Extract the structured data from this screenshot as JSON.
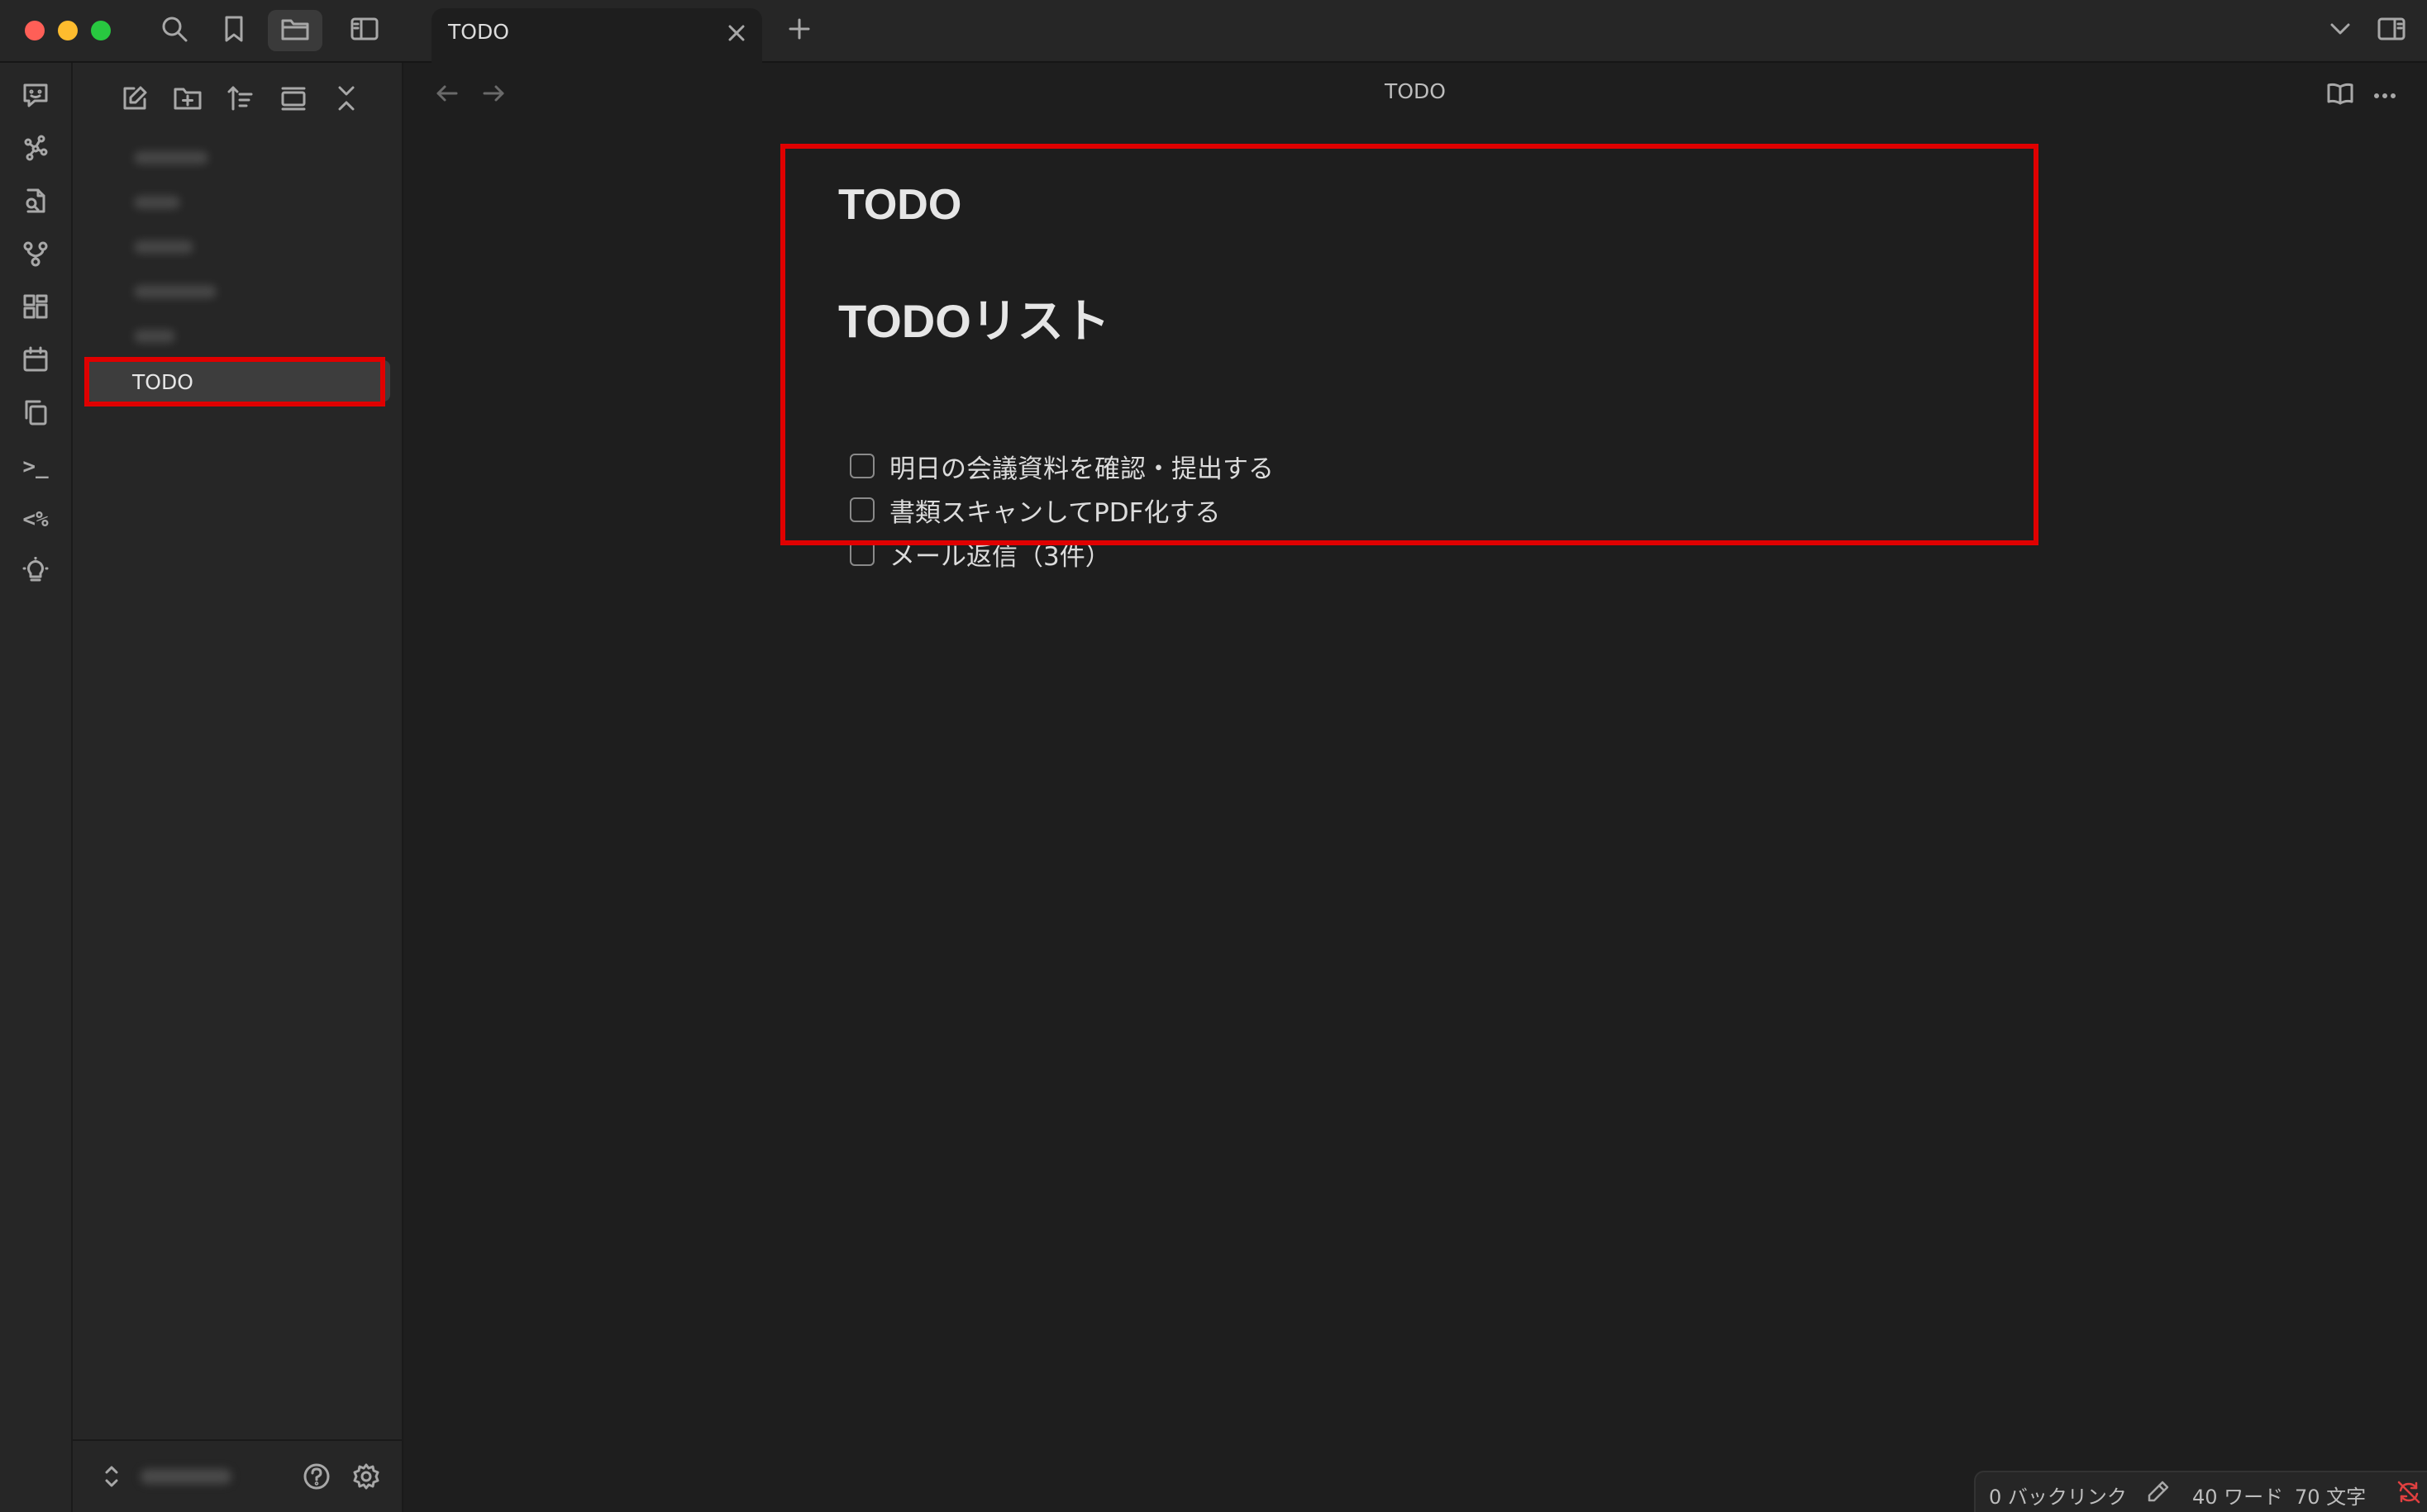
{
  "titlebar": {
    "tab_label": "TODO",
    "icons": [
      "search-icon",
      "bookmark-icon",
      "folder-icon",
      "sidebar-toggle-icon"
    ],
    "right_icons": [
      "chevron-down-icon",
      "right-sidebar-icon"
    ]
  },
  "ribbon": {
    "items": [
      "chat-icon",
      "graph-icon",
      "file-search-icon",
      "git-branch-icon",
      "dashboard-icon",
      "calendar-icon",
      "copy-icon",
      "terminal-icon",
      "templater-icon",
      "lightbulb-icon"
    ],
    "terminal_glyph": ">_",
    "templater_glyph": "<%"
  },
  "sidebar": {
    "toolbar": [
      "new-note-icon",
      "new-folder-icon",
      "sort-icon",
      "collapse-view-icon",
      "collapse-all-icon"
    ],
    "selected_item": "TODO"
  },
  "main": {
    "view_title": "TODO",
    "note_title": "TODO",
    "heading": "TODOリスト",
    "tasks": [
      "明日の会議資料を確認・提出する",
      "書類スキャンしてPDF化する",
      "メール返信（3件）"
    ]
  },
  "status": {
    "backlinks": "0 バックリンク",
    "words": "40 ワード",
    "chars": "70 文字"
  },
  "colors": {
    "highlight": "#e00000",
    "background": "#1e1e1e",
    "panel": "#262626"
  }
}
